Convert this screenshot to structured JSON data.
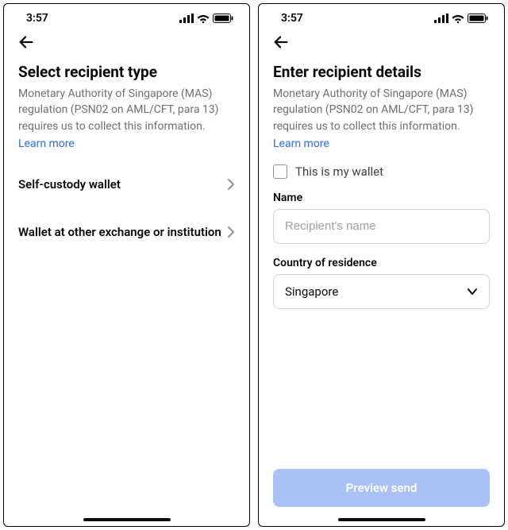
{
  "statusbar": {
    "time": "3:57"
  },
  "screenA": {
    "title": "Select recipient type",
    "subtitle": "Monetary Authority of Singapore (MAS) regulation (PSN02 on AML/CFT, para 13) requires us to collect this information.",
    "learn_more": "Learn more",
    "options": [
      {
        "label": "Self-custody wallet"
      },
      {
        "label": "Wallet at other exchange or institution"
      }
    ]
  },
  "screenB": {
    "title": "Enter recipient details",
    "subtitle": "Monetary Authority of Singapore (MAS) regulation (PSN02 on AML/CFT, para 13) requires us to collect this information.",
    "learn_more": "Learn more",
    "checkbox_label": "This is my wallet",
    "name_field": {
      "label": "Name",
      "placeholder": "Recipient's name",
      "value": ""
    },
    "country_field": {
      "label": "Country of residence",
      "value": "Singapore"
    },
    "primary_button": "Preview send"
  }
}
